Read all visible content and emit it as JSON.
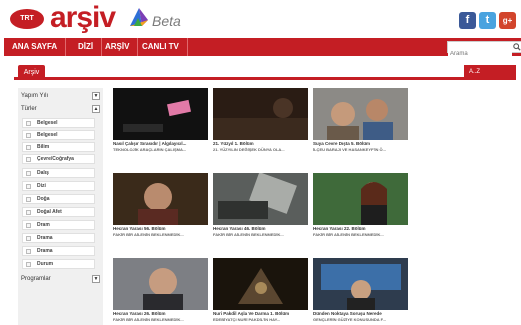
{
  "brand": {
    "logo_badge": "TRT",
    "logo_text": "arşiv",
    "beta_label": "Beta"
  },
  "social": [
    {
      "name": "facebook",
      "glyph": "f",
      "color": "#3b5998"
    },
    {
      "name": "twitter",
      "glyph": "t",
      "color": "#4aa3df"
    },
    {
      "name": "google-plus",
      "glyph": "g+",
      "color": "#d2452c"
    }
  ],
  "nav": {
    "items": [
      "ANA SAYFA",
      "DİZİ",
      "ARŞİV",
      "CANLI TV"
    ],
    "search_placeholder": "Arama"
  },
  "tabs": {
    "active": "Arşiv",
    "right": "A..Z"
  },
  "sidebar": {
    "sections": [
      {
        "label": "Yapım Yılı",
        "toggle": "▼"
      },
      {
        "label": "Türler",
        "toggle": "▲"
      },
      {
        "label": "Programlar",
        "toggle": "▼"
      }
    ],
    "genres": [
      "Belgesel",
      "Belgesel",
      "Bilim",
      "Çevre/Coğrafya",
      "Dalış",
      "Dizi",
      "Doğa",
      "Doğal Afet",
      "Dram",
      "Drama",
      "Drama",
      "Durum"
    ]
  },
  "videos": [
    {
      "title": "Nasıl Çalışır Sırasıdır | Algılayıcıl...",
      "subtitle": "TEKNOLOJİK ARAÇLARIN ÇALIŞMA..."
    },
    {
      "title": "21. Yüzyıl 1. Bölüm",
      "subtitle": "21. YÜZYILIN DEĞİŞEK DÜNYA OLA..."
    },
    {
      "title": "Suya Cevre Dışta 5. Bölüm",
      "subtitle": "İLÇEU BARAJI VE HASANKEYF'İN Ö..."
    },
    {
      "title": "Hecran Yarası 56. Bölüm",
      "subtitle": "FAKİR BİR AİLENİN BEKLENMEDİK..."
    },
    {
      "title": "Hecran Yarası 46. Bölüm",
      "subtitle": "FAKİR BİR AİLENİN BEKLENMEDİK..."
    },
    {
      "title": "Hecran Yarası 22. Bölüm",
      "subtitle": "FAKİR BİR AİLENİN BEKLENMEDİK..."
    },
    {
      "title": "Hecran Yarası 26. Bölüm",
      "subtitle": "FAKİR BİR AİLENİN BEKLENMEDİK..."
    },
    {
      "title": "Nuri Pakdil Aşla Ve Darma 1. Bölüm",
      "subtitle": "EDEBİYATÇI NURİ PAKDİL'İN HAY..."
    },
    {
      "title": "Dünden Noktaya Soruşu Nerede",
      "subtitle": "GENÇLERİN GÜZİYE KONUSUNDA F..."
    }
  ],
  "colors": {
    "brand_red": "#c41e24"
  }
}
